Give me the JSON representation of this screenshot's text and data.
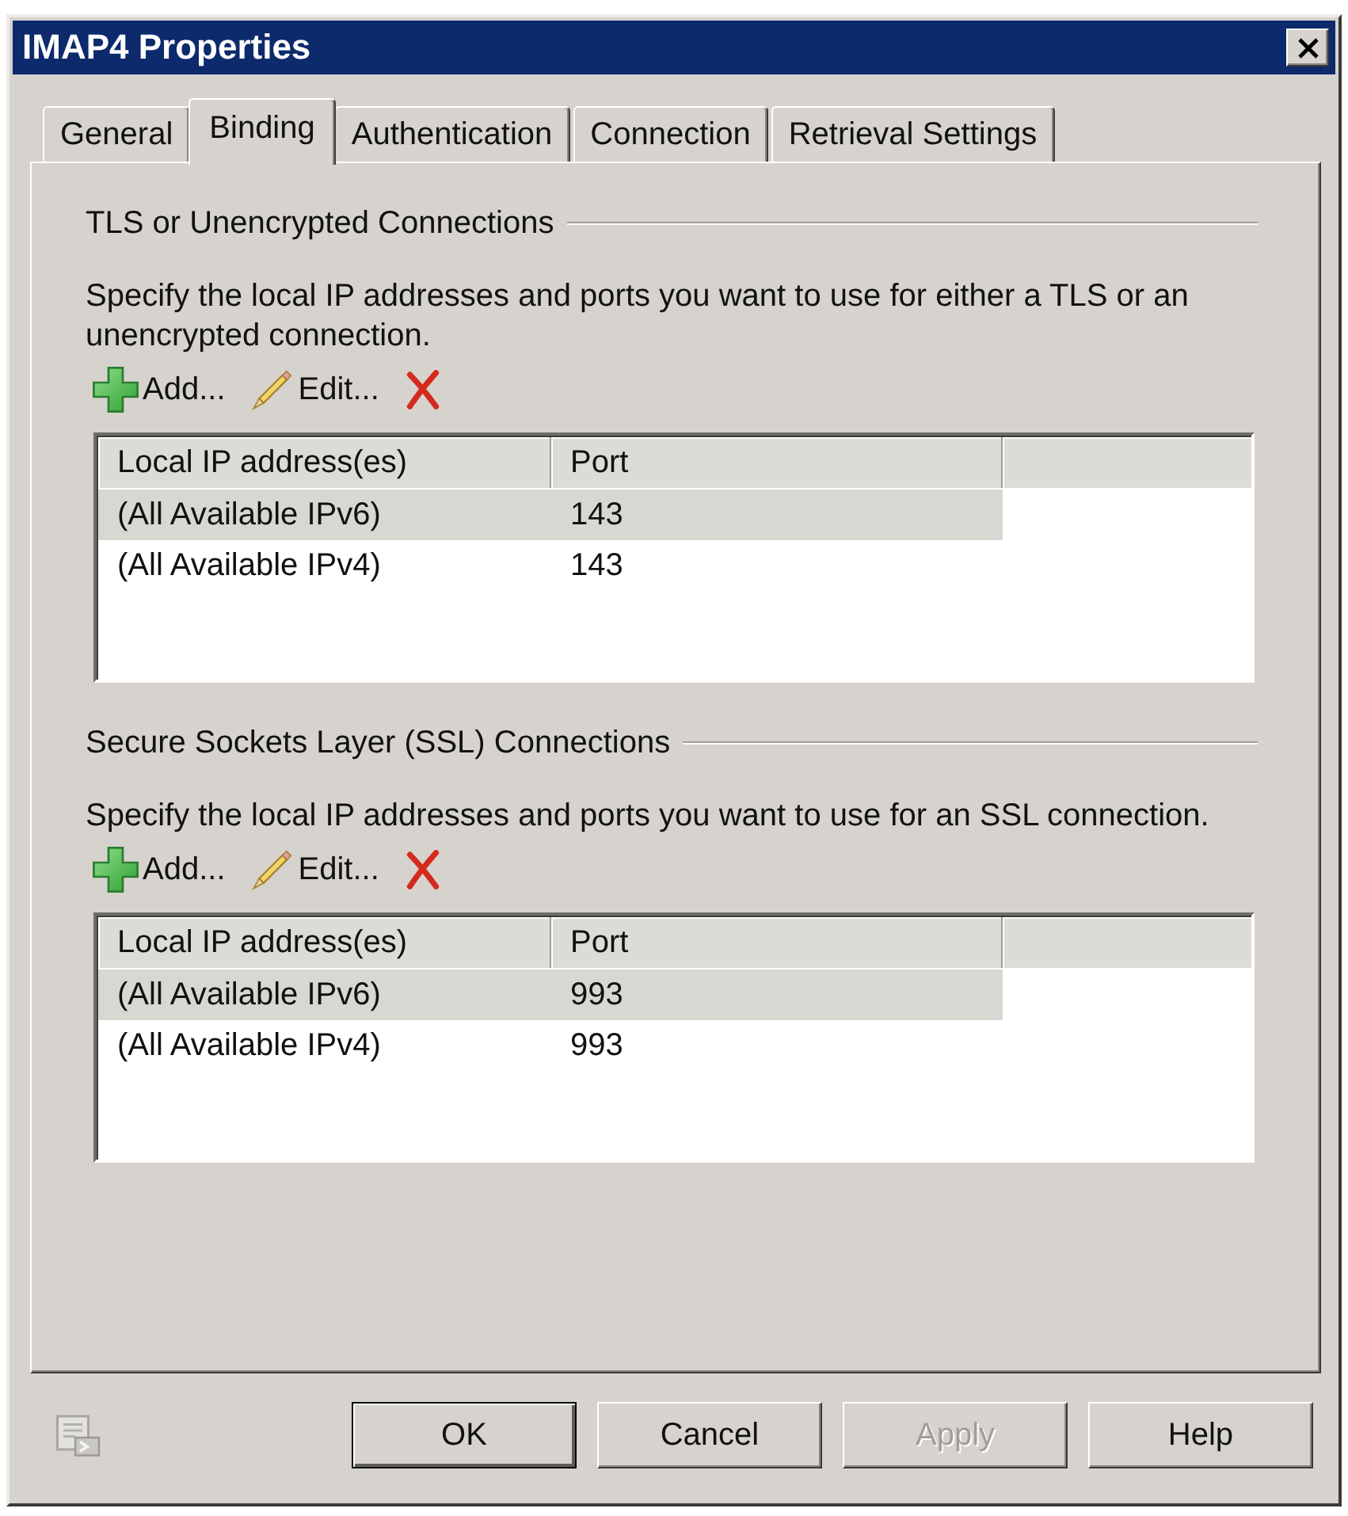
{
  "window": {
    "title": "IMAP4 Properties"
  },
  "tabs": [
    {
      "label": "General",
      "selected": false
    },
    {
      "label": "Binding",
      "selected": true
    },
    {
      "label": "Authentication",
      "selected": false
    },
    {
      "label": "Connection",
      "selected": false
    },
    {
      "label": "Retrieval Settings",
      "selected": false
    }
  ],
  "groups": [
    {
      "title": "TLS or Unencrypted Connections",
      "description": "Specify the local IP addresses and ports you want to use for either a TLS or an unencrypted connection.",
      "toolbar": [
        {
          "kind": "add",
          "label": "Add..."
        },
        {
          "kind": "edit",
          "label": "Edit..."
        },
        {
          "kind": "remove"
        }
      ],
      "table": {
        "columns": [
          "Local IP address(es)",
          "Port"
        ],
        "rows": [
          {
            "cells": [
              "(All Available IPv6)",
              "143"
            ],
            "selected": true
          },
          {
            "cells": [
              "(All Available IPv4)",
              "143"
            ],
            "selected": false
          }
        ]
      }
    },
    {
      "title": "Secure Sockets Layer (SSL) Connections",
      "description": "Specify the local IP addresses and ports you want to use for an SSL connection.",
      "toolbar": [
        {
          "kind": "add",
          "label": "Add..."
        },
        {
          "kind": "edit",
          "label": "Edit..."
        },
        {
          "kind": "remove"
        }
      ],
      "table": {
        "columns": [
          "Local IP address(es)",
          "Port"
        ],
        "rows": [
          {
            "cells": [
              "(All Available IPv6)",
              "993"
            ],
            "selected": true
          },
          {
            "cells": [
              "(All Available IPv4)",
              "993"
            ],
            "selected": false
          }
        ]
      }
    }
  ],
  "footer": {
    "buttons": [
      {
        "label": "OK",
        "default": true,
        "disabled": false
      },
      {
        "label": "Cancel",
        "default": false,
        "disabled": false
      },
      {
        "label": "Apply",
        "default": false,
        "disabled": true
      },
      {
        "label": "Help",
        "default": false,
        "disabled": false
      }
    ]
  }
}
